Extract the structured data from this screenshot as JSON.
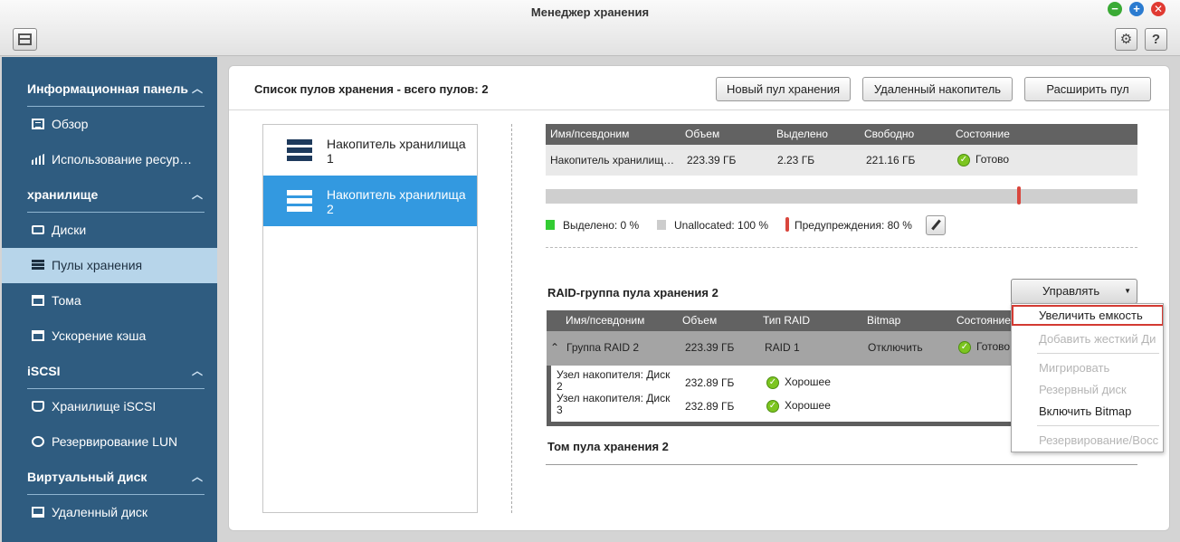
{
  "window": {
    "title": "Менеджер хранения"
  },
  "sidebar": {
    "groups": [
      {
        "label": "Информационная панель",
        "items": [
          {
            "label": "Обзор",
            "icon": "overview-icon"
          },
          {
            "label": "Использование ресур…",
            "icon": "resource-usage-icon"
          }
        ]
      },
      {
        "label": "хранилище",
        "items": [
          {
            "label": "Диски",
            "icon": "disk-icon"
          },
          {
            "label": "Пулы хранения",
            "icon": "storage-pool-icon",
            "active": true
          },
          {
            "label": "Тома",
            "icon": "volume-icon"
          },
          {
            "label": "Ускорение кэша",
            "icon": "cache-icon"
          }
        ]
      },
      {
        "label": "iSCSI",
        "items": [
          {
            "label": "Хранилище iSCSI",
            "icon": "iscsi-storage-icon"
          },
          {
            "label": "Резервирование LUN",
            "icon": "lun-backup-icon"
          }
        ]
      },
      {
        "label": "Виртуальный диск",
        "items": [
          {
            "label": "Удаленный диск",
            "icon": "remote-disk-icon"
          }
        ]
      }
    ]
  },
  "main": {
    "header": "Список пулов хранения - всего пулов: 2",
    "buttons": {
      "new_pool": "Новый пул хранения",
      "remote_disk": "Удаленный накопитель",
      "expand_pool": "Расширить пул"
    },
    "pools": [
      {
        "line1": "Накопитель хранилища",
        "line2": "1"
      },
      {
        "line1": "Накопитель хранилища",
        "line2": "2",
        "selected": true
      }
    ],
    "pool_table": {
      "columns": [
        "Имя/псевдоним",
        "Объем",
        "Выделено",
        "Свободно",
        "Состояние"
      ],
      "row": {
        "name": "Накопитель хранилищ…",
        "size": "223.39 ГБ",
        "allocated": "2.23 ГБ",
        "free": "221.16 ГБ",
        "status": "Готово"
      }
    },
    "capacity": {
      "allocated_percent": 0,
      "warning_threshold_percent": 80,
      "legend": {
        "allocated": "Выделено: 0 %",
        "unallocated": "Unallocated: 100 %",
        "warning": "Предупреждения: 80 %"
      },
      "colors": {
        "allocated": "#33cc33",
        "unallocated": "#cccccc",
        "warning": "#d9463d"
      }
    },
    "raid": {
      "title": "RAID-группа пула хранения 2",
      "manage_label": "Управлять",
      "columns": [
        "Имя/псевдоним",
        "Объем",
        "Тип RAID",
        "Bitmap",
        "Состояние"
      ],
      "group": {
        "name": "Группа RAID 2",
        "size": "223.39 ГБ",
        "type": "RAID 1",
        "bitmap": "Отключить",
        "status": "Готово"
      },
      "disks": [
        {
          "line1": "Узел накопителя: Диск",
          "line2": "2",
          "size": "232.89 ГБ",
          "status": "Хорошее"
        },
        {
          "line1": "Узел накопителя: Диск",
          "line2": "3",
          "size": "232.89 ГБ",
          "status": "Хорошее"
        }
      ]
    },
    "volume_title": "Том пула хранения 2"
  },
  "dropdown": {
    "items": [
      {
        "label": "Увеличить емкость"
      },
      {
        "label": "Добавить жесткий Ди"
      },
      {
        "label": "Мигрировать"
      },
      {
        "label": "Резервный диск"
      },
      {
        "label": "Включить Bitmap"
      },
      {
        "label": "Резервирование/Восс"
      }
    ]
  }
}
